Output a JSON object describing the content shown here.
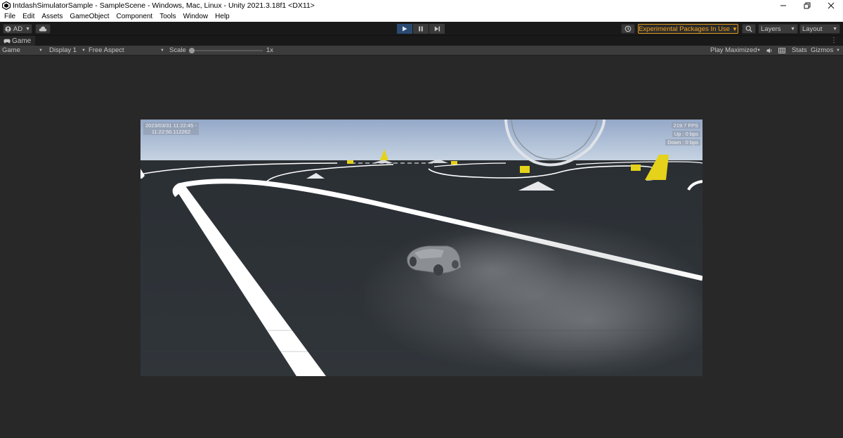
{
  "window": {
    "title": "IntdashSimulatorSample - SampleScene - Windows, Mac, Linux - Unity 2021.3.18f1 <DX11>",
    "controls": [
      "minimize",
      "restore",
      "close"
    ]
  },
  "menu": {
    "items": [
      "File",
      "Edit",
      "Assets",
      "GameObject",
      "Component",
      "Tools",
      "Window",
      "Help"
    ]
  },
  "toolbar": {
    "account_label": "AD",
    "experimental_label": "Experimental Packages In Use",
    "layers_label": "Layers",
    "layout_label": "Layout",
    "play_state": "playing"
  },
  "game_tab": {
    "label": "Game"
  },
  "game_bar": {
    "view_mode": "Game",
    "display": "Display 1",
    "aspect": "Free Aspect",
    "scale_label": "Scale",
    "scale_value": "1x",
    "play_mode": "Play Maximized",
    "stats_label": "Stats",
    "gizmos_label": "Gizmos"
  },
  "hud": {
    "timestamp_line1": "2023/03/31 11:22:45 -",
    "timestamp_line2": "11:22:50.112262",
    "fps": "219.7 FPS",
    "up": "Up : 0 bps",
    "down": "Down : 0 bps"
  },
  "colors": {
    "accent_orange": "#e39a18",
    "play_active": "#2a4a72",
    "sky_top": "#94a8c8",
    "ground": "#2e3236",
    "track_line": "#ffffff",
    "cone_yellow": "#e5d21a"
  },
  "icons": {
    "unity": "unity-logo-icon",
    "account": "account-icon",
    "cloud": "cloud-icon",
    "play": "play-icon",
    "pause": "pause-icon",
    "step": "step-icon",
    "history": "history-icon",
    "search": "search-icon",
    "audio": "speaker-icon",
    "stats_grid": "grid-icon"
  }
}
